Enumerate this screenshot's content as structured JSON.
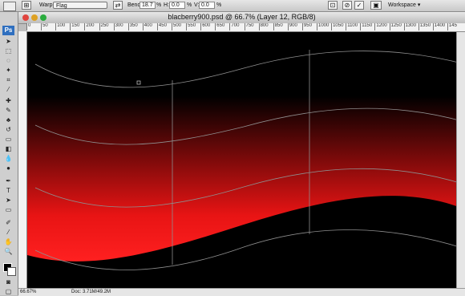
{
  "options_bar": {
    "warp_label": "Warp:",
    "warp_value": "Flag",
    "bend_label": "Bend:",
    "bend_value": "18.7",
    "bend_unit": "%",
    "h_label": "H:",
    "h_value": "0.0",
    "h_unit": "%",
    "v_label": "V:",
    "v_value": "0.0",
    "v_unit": "%",
    "workspace_label": "Workspace"
  },
  "document": {
    "title": "blacberry900.psd @ 66.7% (Layer 12, RGB/8)"
  },
  "ruler": {
    "ticks": [
      "0",
      "50",
      "100",
      "150",
      "200",
      "250",
      "300",
      "350",
      "400",
      "450",
      "500",
      "550",
      "600",
      "650",
      "700",
      "750",
      "800",
      "850",
      "900",
      "950",
      "1000",
      "1050",
      "1100",
      "1150",
      "1200",
      "1250",
      "1300",
      "1350",
      "1400",
      "145"
    ]
  },
  "toolbox": {
    "logo": "Ps"
  },
  "status": {
    "zoom": "66.67%",
    "doc_size": "Doc: 3.71M/49.2M"
  },
  "colors": {
    "accent_red": "#ff1a1a",
    "canvas_black": "#000000"
  }
}
